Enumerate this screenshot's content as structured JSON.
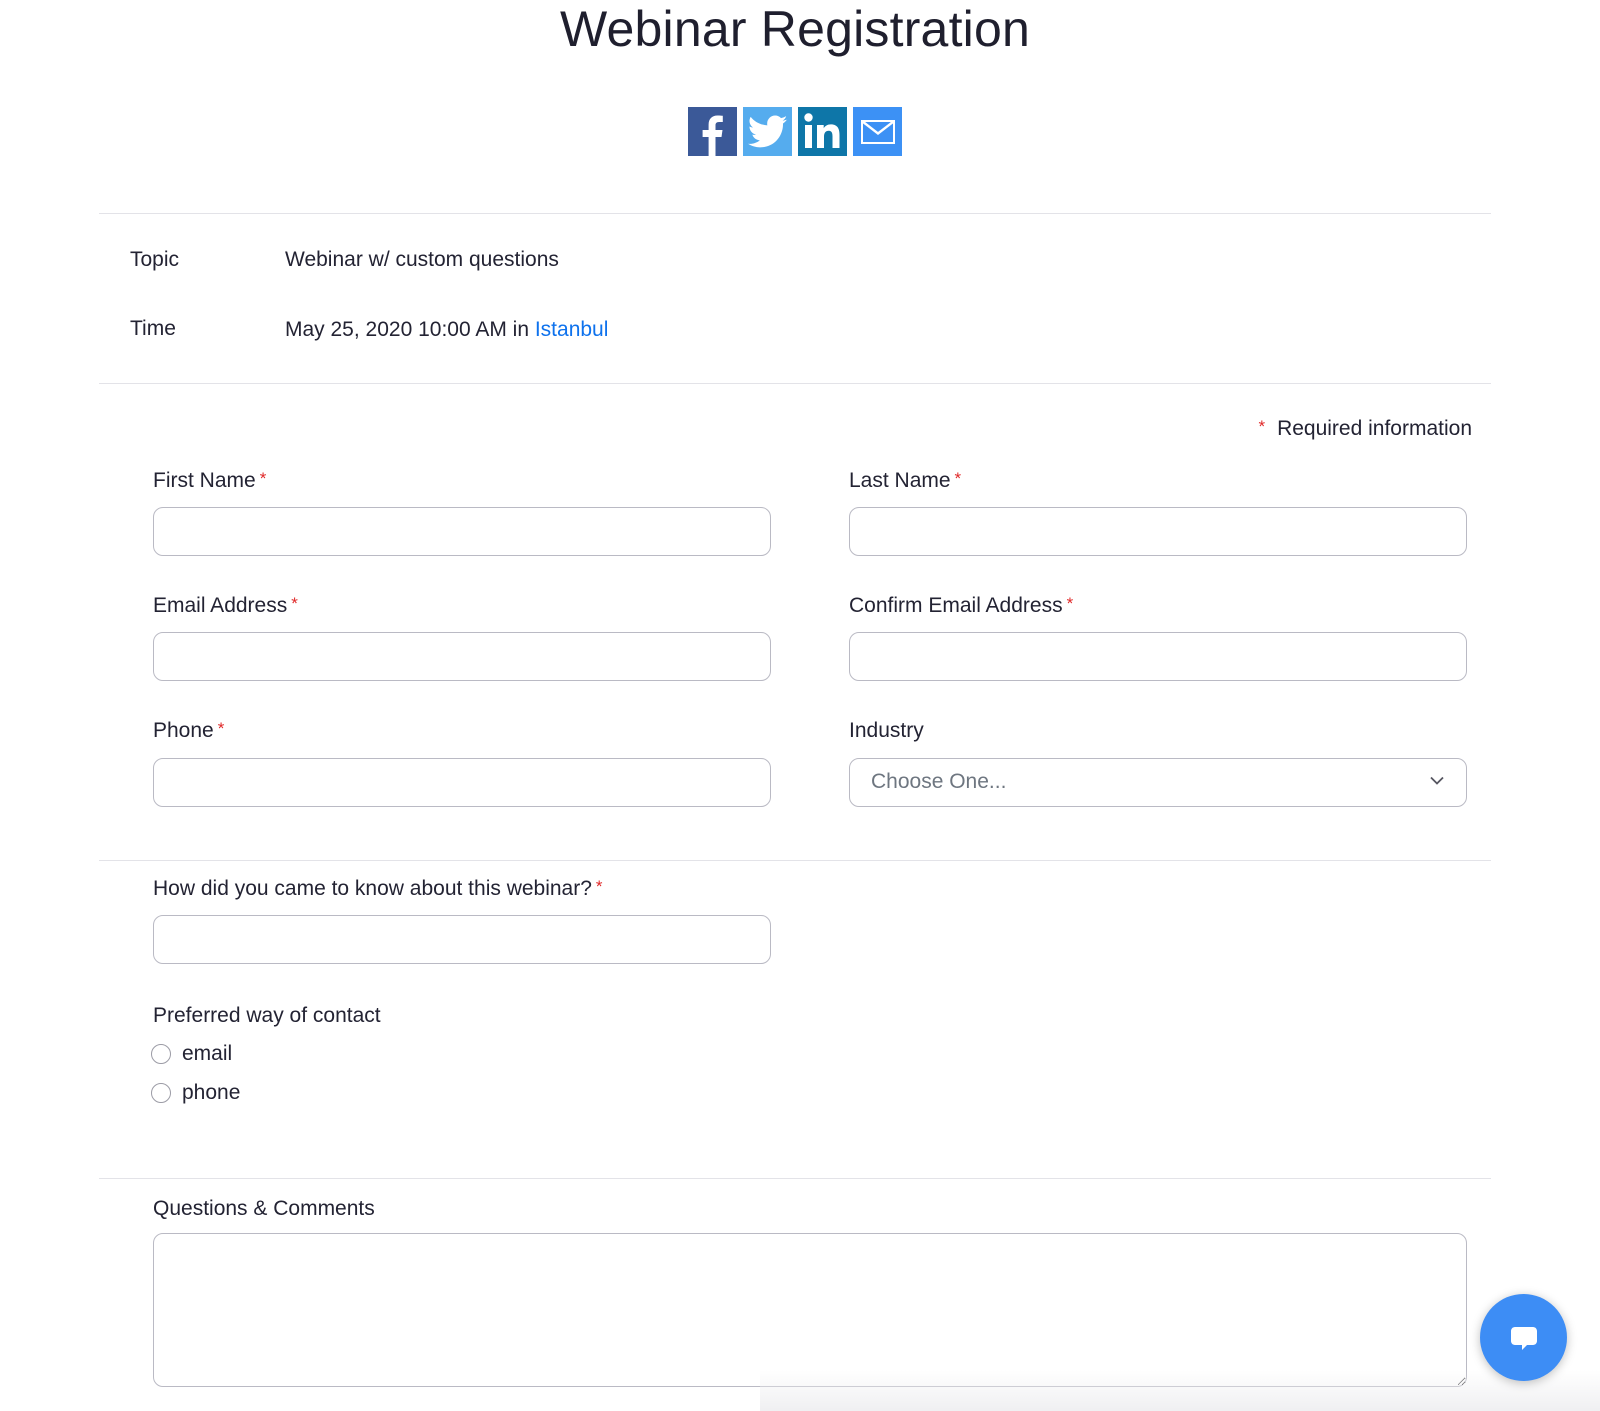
{
  "page": {
    "title": "Webinar Registration"
  },
  "share": {
    "buttons": [
      {
        "network": "facebook",
        "icon": "facebook-icon",
        "color": "#3b5998"
      },
      {
        "network": "twitter",
        "icon": "twitter-icon",
        "color": "#55acee"
      },
      {
        "network": "linkedin",
        "icon": "linkedin-icon",
        "color": "#0e76a8"
      },
      {
        "network": "email",
        "icon": "mail-icon",
        "color": "#3c91f5"
      }
    ]
  },
  "details": {
    "topic_label": "Topic",
    "topic_value": "Webinar w/ custom questions",
    "time_label": "Time",
    "time_value": "May 25, 2020 10:00 AM in",
    "time_zone_link": "Istanbul"
  },
  "form": {
    "required_marker": "*",
    "required_note": "Required information",
    "first_name": {
      "label": "First Name",
      "value": "",
      "required": true
    },
    "last_name": {
      "label": "Last Name",
      "value": "",
      "required": true
    },
    "email": {
      "label": "Email Address",
      "value": "",
      "required": true
    },
    "confirm_email": {
      "label": "Confirm Email Address",
      "value": "",
      "required": true
    },
    "phone": {
      "label": "Phone",
      "value": "",
      "required": true
    },
    "industry": {
      "label": "Industry",
      "selected": "Choose One...",
      "required": false
    },
    "how_heard": {
      "label": "How did you came to know about this webinar?",
      "value": "",
      "required": true
    },
    "preferred_contact": {
      "label": "Preferred way of contact",
      "options": [
        "email",
        "phone"
      ],
      "selected": null
    },
    "comments": {
      "label": "Questions & Comments",
      "value": ""
    }
  },
  "colors": {
    "accent": "#0e72ed",
    "required": "#e02828",
    "chat_button": "#3d8df5"
  },
  "chat": {
    "icon": "chat-bubble-icon"
  }
}
